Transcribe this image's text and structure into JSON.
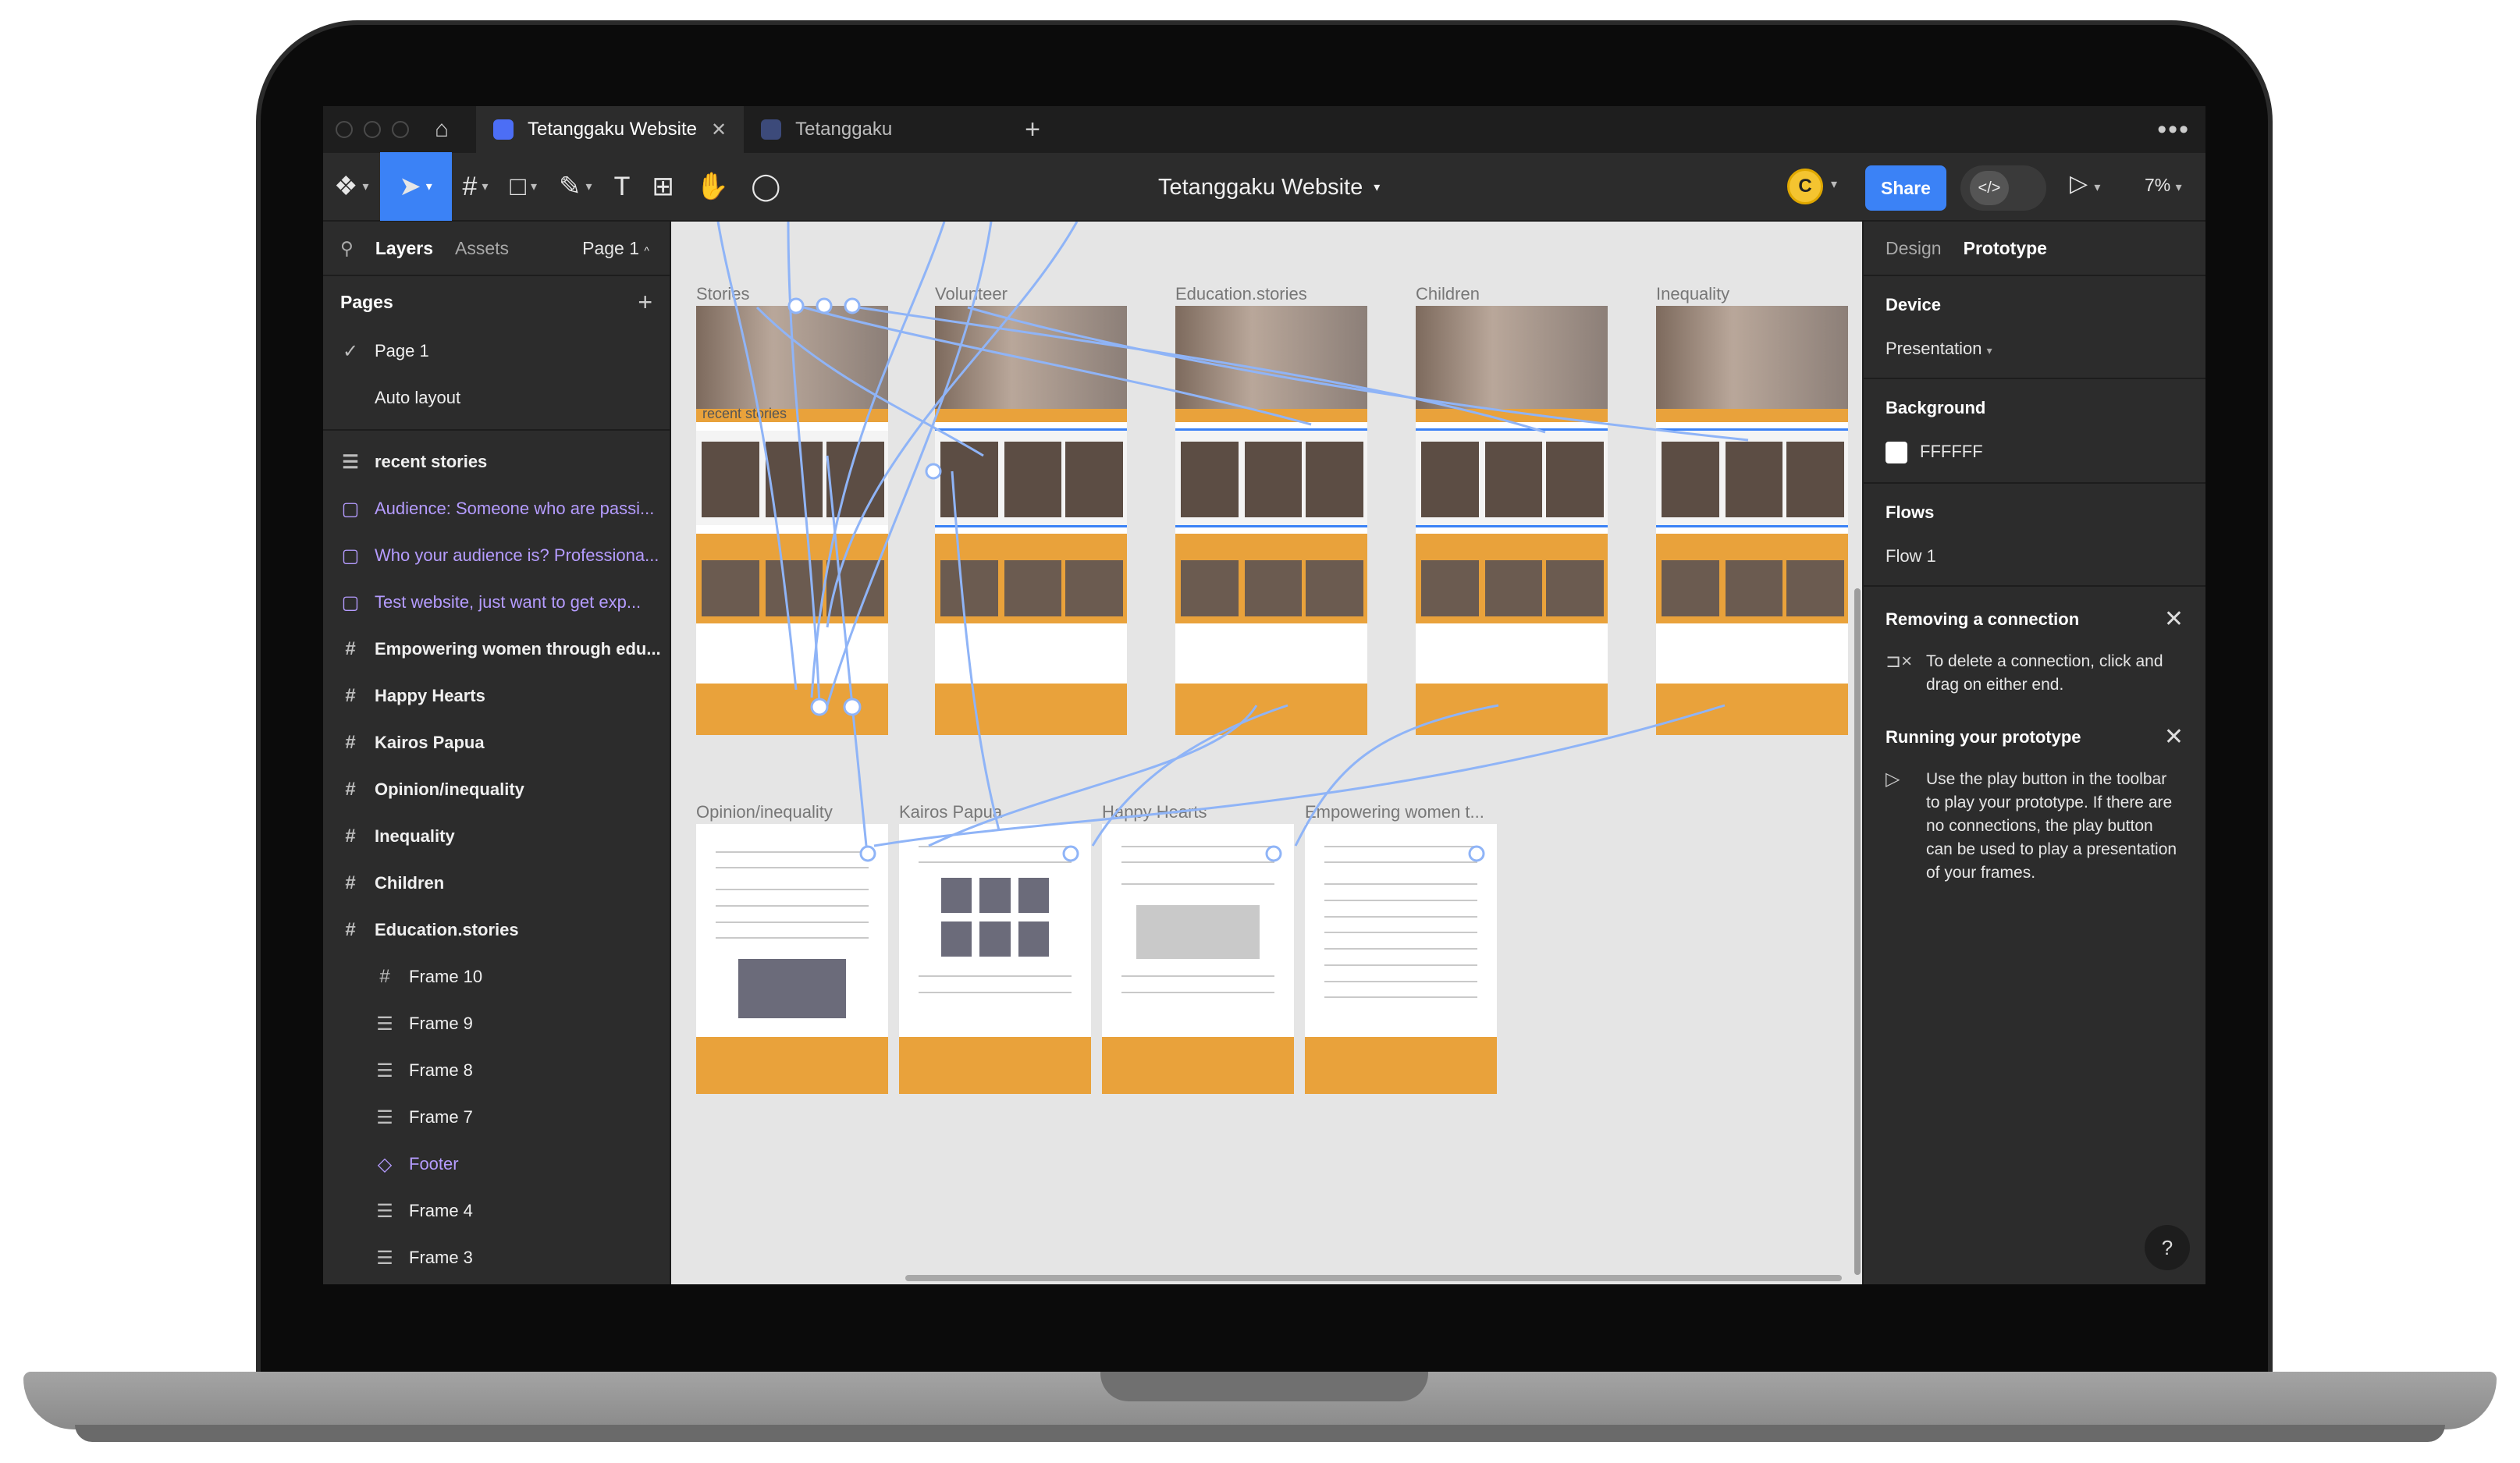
{
  "tabs": [
    {
      "label": "Tetanggaku Website",
      "active": true
    },
    {
      "label": "Tetanggaku",
      "active": false
    }
  ],
  "toolbar": {
    "doc_title": "Tetanggaku Website",
    "avatar_initial": "C",
    "share_label": "Share",
    "devmode_label": "</>",
    "zoom": "7%"
  },
  "left_panel": {
    "tab_layers": "Layers",
    "tab_assets": "Assets",
    "page_selector": "Page 1",
    "pages_heading": "Pages",
    "pages": [
      {
        "label": "Page 1",
        "selected": true
      },
      {
        "label": "Auto layout",
        "selected": false
      }
    ],
    "layers": [
      {
        "label": "recent stories",
        "icon": "text-layers-icon",
        "style": "bold"
      },
      {
        "label": "Audience: Someone who are passi...",
        "icon": "comment-note-icon",
        "style": "purple"
      },
      {
        "label": "Who your audience is? Professiona...",
        "icon": "comment-note-icon",
        "style": "purple"
      },
      {
        "label": "Test website, just want to get exp...",
        "icon": "comment-note-icon",
        "style": "purple"
      },
      {
        "label": "Empowering women through edu...",
        "icon": "frame-icon",
        "style": "bold"
      },
      {
        "label": "Happy Hearts",
        "icon": "frame-icon",
        "style": "bold"
      },
      {
        "label": "Kairos Papua",
        "icon": "frame-icon",
        "style": "bold"
      },
      {
        "label": "Opinion/inequality",
        "icon": "frame-icon",
        "style": "bold"
      },
      {
        "label": "Inequality",
        "icon": "frame-icon",
        "style": "bold"
      },
      {
        "label": "Children",
        "icon": "frame-icon",
        "style": "bold"
      },
      {
        "label": "Education.stories",
        "icon": "frame-icon",
        "style": "bold"
      },
      {
        "label": "Frame 10",
        "icon": "frame-icon",
        "style": "sub"
      },
      {
        "label": "Frame 9",
        "icon": "autolayout-icon",
        "style": "sub"
      },
      {
        "label": "Frame 8",
        "icon": "autolayout-icon",
        "style": "sub"
      },
      {
        "label": "Frame 7",
        "icon": "autolayout-icon",
        "style": "sub"
      },
      {
        "label": "Footer",
        "icon": "component-icon",
        "style": "sub-purple"
      },
      {
        "label": "Frame 4",
        "icon": "autolayout-icon",
        "style": "sub"
      },
      {
        "label": "Frame 3",
        "icon": "autolayout-icon",
        "style": "sub"
      }
    ]
  },
  "canvas": {
    "row1_labels": [
      "Stories",
      "Volunteer",
      "Education.stories",
      "Children",
      "Inequality"
    ],
    "row2_labels": [
      "Opinion/inequality",
      "Kairos Papua",
      "Happy Hearts",
      "Empowering women t..."
    ],
    "overlay_text": "recent stories",
    "background": "#E5E5E5",
    "accent_orange": "#E9A23B",
    "selection_blue": "#3B82F6"
  },
  "right_panel": {
    "tab_design": "Design",
    "tab_prototype": "Prototype",
    "device_heading": "Device",
    "device_value": "Presentation",
    "background_heading": "Background",
    "background_value": "FFFFFF",
    "flows_heading": "Flows",
    "flow_value": "Flow 1",
    "hint1_title": "Removing a connection",
    "hint1_body": "To delete a connection, click and drag on either end.",
    "hint2_title": "Running your prototype",
    "hint2_body": "Use the play button in the toolbar to play your prototype. If there are no connections, the play button can be used to play a presentation of your frames.",
    "help_label": "?"
  }
}
